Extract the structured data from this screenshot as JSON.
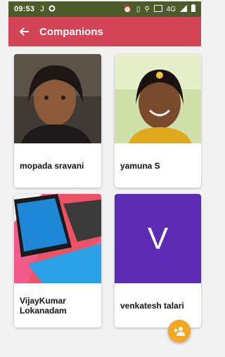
{
  "status_bar": {
    "time": "09:53",
    "left_icons": [
      "sim-icon",
      "whatsapp-icon"
    ],
    "right_icons": [
      "alarm-icon",
      "vibrate-icon",
      "location-icon",
      "hd-icon",
      "4g-icon",
      "signal-icon",
      "battery-icon"
    ],
    "network_label": "4G"
  },
  "app_bar": {
    "title": "Companions",
    "back_icon": "arrow-back-icon",
    "color": "#d24456"
  },
  "companions": [
    {
      "name": "mopada sravani",
      "photo": "portrait-photo"
    },
    {
      "name": "yamuna S",
      "photo": "portrait-photo"
    },
    {
      "name": "VijayKumar Lokanadam",
      "photo": "tablet-photo"
    },
    {
      "name": "venkatesh talari",
      "avatar_letter": "V",
      "avatar_color": "#5b2bb3"
    }
  ],
  "fab": {
    "icon": "add-person-icon",
    "color": "#f5a623"
  }
}
